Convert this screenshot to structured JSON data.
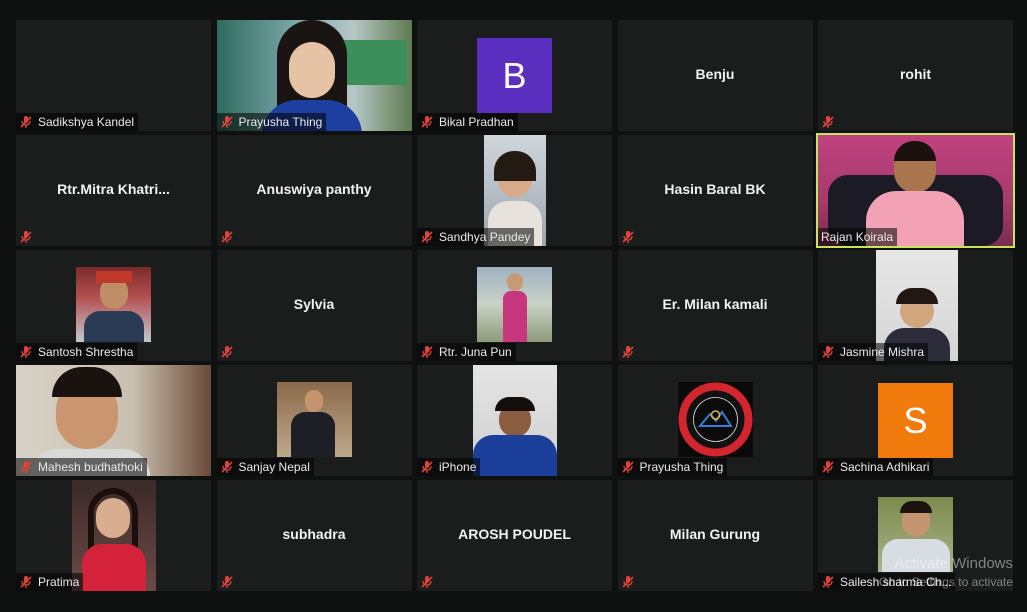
{
  "participants": [
    {
      "name": "Sadikshya Kandel",
      "display": "",
      "video": false
    },
    {
      "name": "Prayusha Thing",
      "display": "",
      "video": true
    },
    {
      "name": "Bikal Pradhan",
      "display": "",
      "avatar": "B",
      "avatar_color": "#5a2fc0"
    },
    {
      "name": "",
      "display": "Benju"
    },
    {
      "name": "",
      "display": "rohit"
    },
    {
      "name": "",
      "display": "Rtr.Mitra  Khatri..."
    },
    {
      "name": "",
      "display": "Anuswiya panthy"
    },
    {
      "name": "Sandhya Pandey",
      "display": "",
      "video": true
    },
    {
      "name": "",
      "display": "Hasin Baral BK"
    },
    {
      "name": "Rajan Koirala",
      "display": "",
      "video": true,
      "active": true
    },
    {
      "name": "Santosh Shrestha",
      "display": "",
      "video": true
    },
    {
      "name": "",
      "display": "Sylvia"
    },
    {
      "name": "Rtr. Juna Pun",
      "display": "",
      "video": true
    },
    {
      "name": "",
      "display": "Er. Milan kamali"
    },
    {
      "name": "Jasmine Mishra",
      "display": "",
      "video": true
    },
    {
      "name": "Mahesh budhathoki",
      "display": "",
      "video": true
    },
    {
      "name": "Sanjay Nepal",
      "display": "",
      "video": true
    },
    {
      "name": "iPhone",
      "display": "",
      "video": true
    },
    {
      "name": "Prayusha Thing",
      "display": "",
      "logo": true
    },
    {
      "name": "Sachina Adhikari",
      "display": "",
      "avatar": "S",
      "avatar_color": "#f07a0c"
    },
    {
      "name": "Pratima",
      "display": "",
      "video": true
    },
    {
      "name": "",
      "display": "subhadra"
    },
    {
      "name": "",
      "display": "AROSH POUDEL"
    },
    {
      "name": "",
      "display": "Milan Gurung"
    },
    {
      "name": "Sailesh sharma Ch...",
      "display": "",
      "video": true
    }
  ],
  "muted_icon": "mic-muted-icon",
  "watermark": {
    "line1": "Activate Windows",
    "line2": "Go to Settings to activate Windows."
  }
}
